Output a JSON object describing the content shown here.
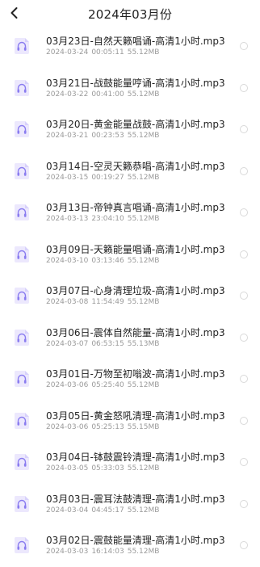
{
  "header": {
    "title": "2024年03月份",
    "back_icon": "chevron-left-icon"
  },
  "colors": {
    "accent": "#8a7cf0",
    "icon_bg": "#ece8fd"
  },
  "files": [
    {
      "name": "03月23日-自然天籁唱诵-高清1小时.mp3",
      "date": "2024-03-24",
      "duration": "00:05:11",
      "size": "55.12MB"
    },
    {
      "name": "03月21日-战鼓能量哼诵-高清1小时.mp3",
      "date": "2024-03-22",
      "duration": "00:41:00",
      "size": "55.12MB"
    },
    {
      "name": "03月20日-黄金能量战鼓-高清1小时.mp3",
      "date": "2024-03-21",
      "duration": "00:23:53",
      "size": "55.12MB"
    },
    {
      "name": "03月14日-空灵天籁恭唱-高清1小时.mp3",
      "date": "2024-03-15",
      "duration": "00:19:27",
      "size": "55.12MB"
    },
    {
      "name": "03月13日-帝钟真言唱诵-高清1小时.mp3",
      "date": "2024-03-13",
      "duration": "23:04:10",
      "size": "55.12MB"
    },
    {
      "name": "03月09日-天籁能量唱诵-高清1小时.mp3",
      "date": "2024-03-10",
      "duration": "03:13:46",
      "size": "55.12MB"
    },
    {
      "name": "03月07日-心身清理垃圾-高清1小时.mp3",
      "date": "2024-03-08",
      "duration": "11:54:49",
      "size": "55.12MB"
    },
    {
      "name": "03月06日-震体自然能量-高清1小时.mp3",
      "date": "2024-03-07",
      "duration": "06:53:15",
      "size": "55.13MB"
    },
    {
      "name": "03月01日-万物至初嗡波-高清1小时.mp3",
      "date": "2024-03-06",
      "duration": "05:25:40",
      "size": "55.12MB"
    },
    {
      "name": "03月05日-黄金怒吼清理-高清1小时.mp3",
      "date": "2024-03-06",
      "duration": "05:25:13",
      "size": "55.15MB"
    },
    {
      "name": "03月04日-钵鼓震铃清理-高清1小时.mp3",
      "date": "2024-03-05",
      "duration": "05:33:03",
      "size": "55.12MB"
    },
    {
      "name": "03月03日-震耳法鼓清理-高清1小时.mp3",
      "date": "2024-03-04",
      "duration": "04:45:17",
      "size": "55.12MB"
    },
    {
      "name": "03月02日-震鼓能量清理-高清1小时.mp3",
      "date": "2024-03-03",
      "duration": "16:14:03",
      "size": "55.12MB"
    }
  ]
}
